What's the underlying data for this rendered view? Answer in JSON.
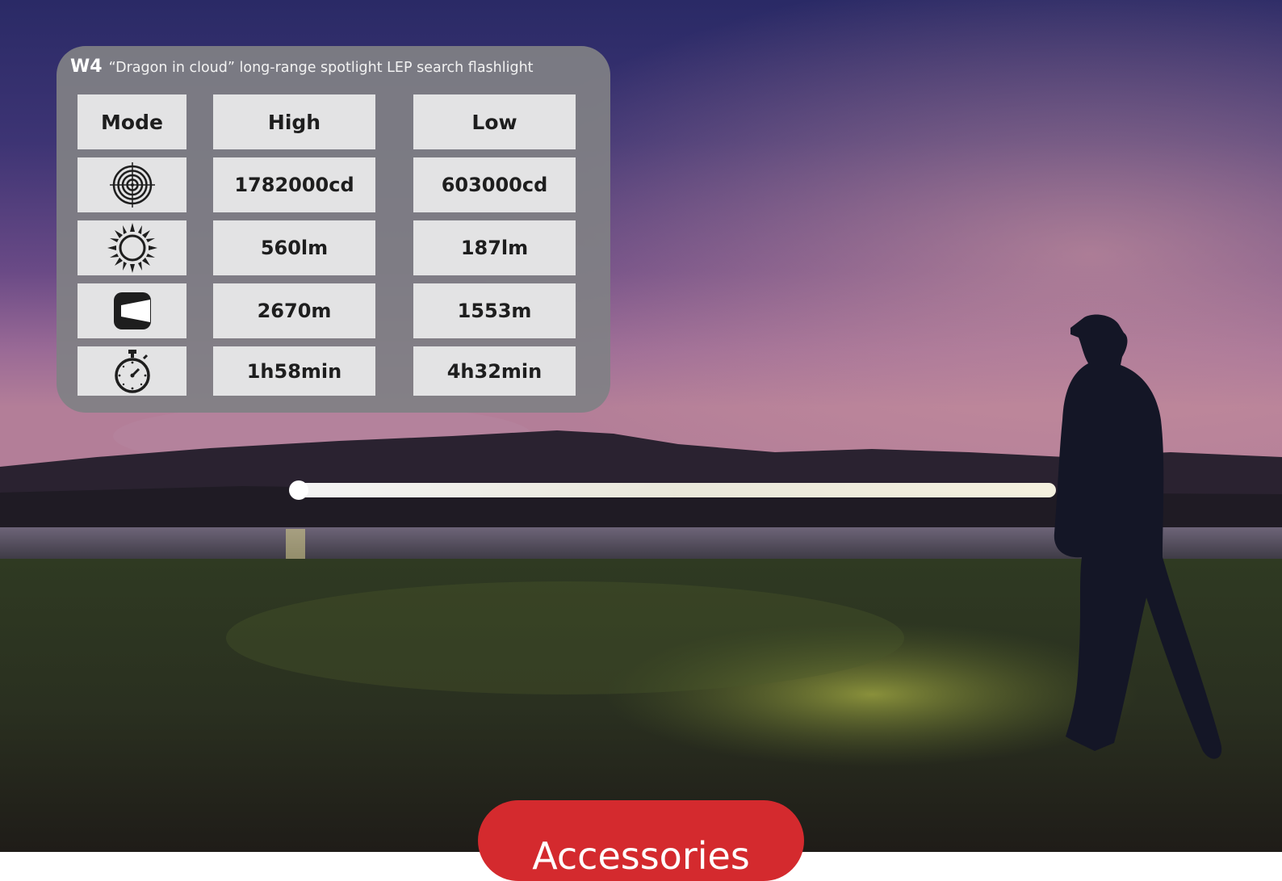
{
  "spec_card": {
    "model": "W4",
    "product_name": "“Dragon in cloud”   long-range spotlight LEP search flashlight",
    "header": {
      "mode": "Mode",
      "high": "High",
      "low": "Low"
    },
    "rows": [
      {
        "icon": "target-icon",
        "high": "1782000cd",
        "low": "603000cd"
      },
      {
        "icon": "sun-icon",
        "high": "560lm",
        "low": "187lm"
      },
      {
        "icon": "beam-distance-icon",
        "high": "2670m",
        "low": "1553m"
      },
      {
        "icon": "stopwatch-icon",
        "high": "1h58min",
        "low": "4h32min"
      }
    ]
  },
  "cta": {
    "label": "Accessories"
  },
  "colors": {
    "panel": "#808084",
    "cell": "#e3e3e4",
    "cta": "#d42a2e"
  }
}
